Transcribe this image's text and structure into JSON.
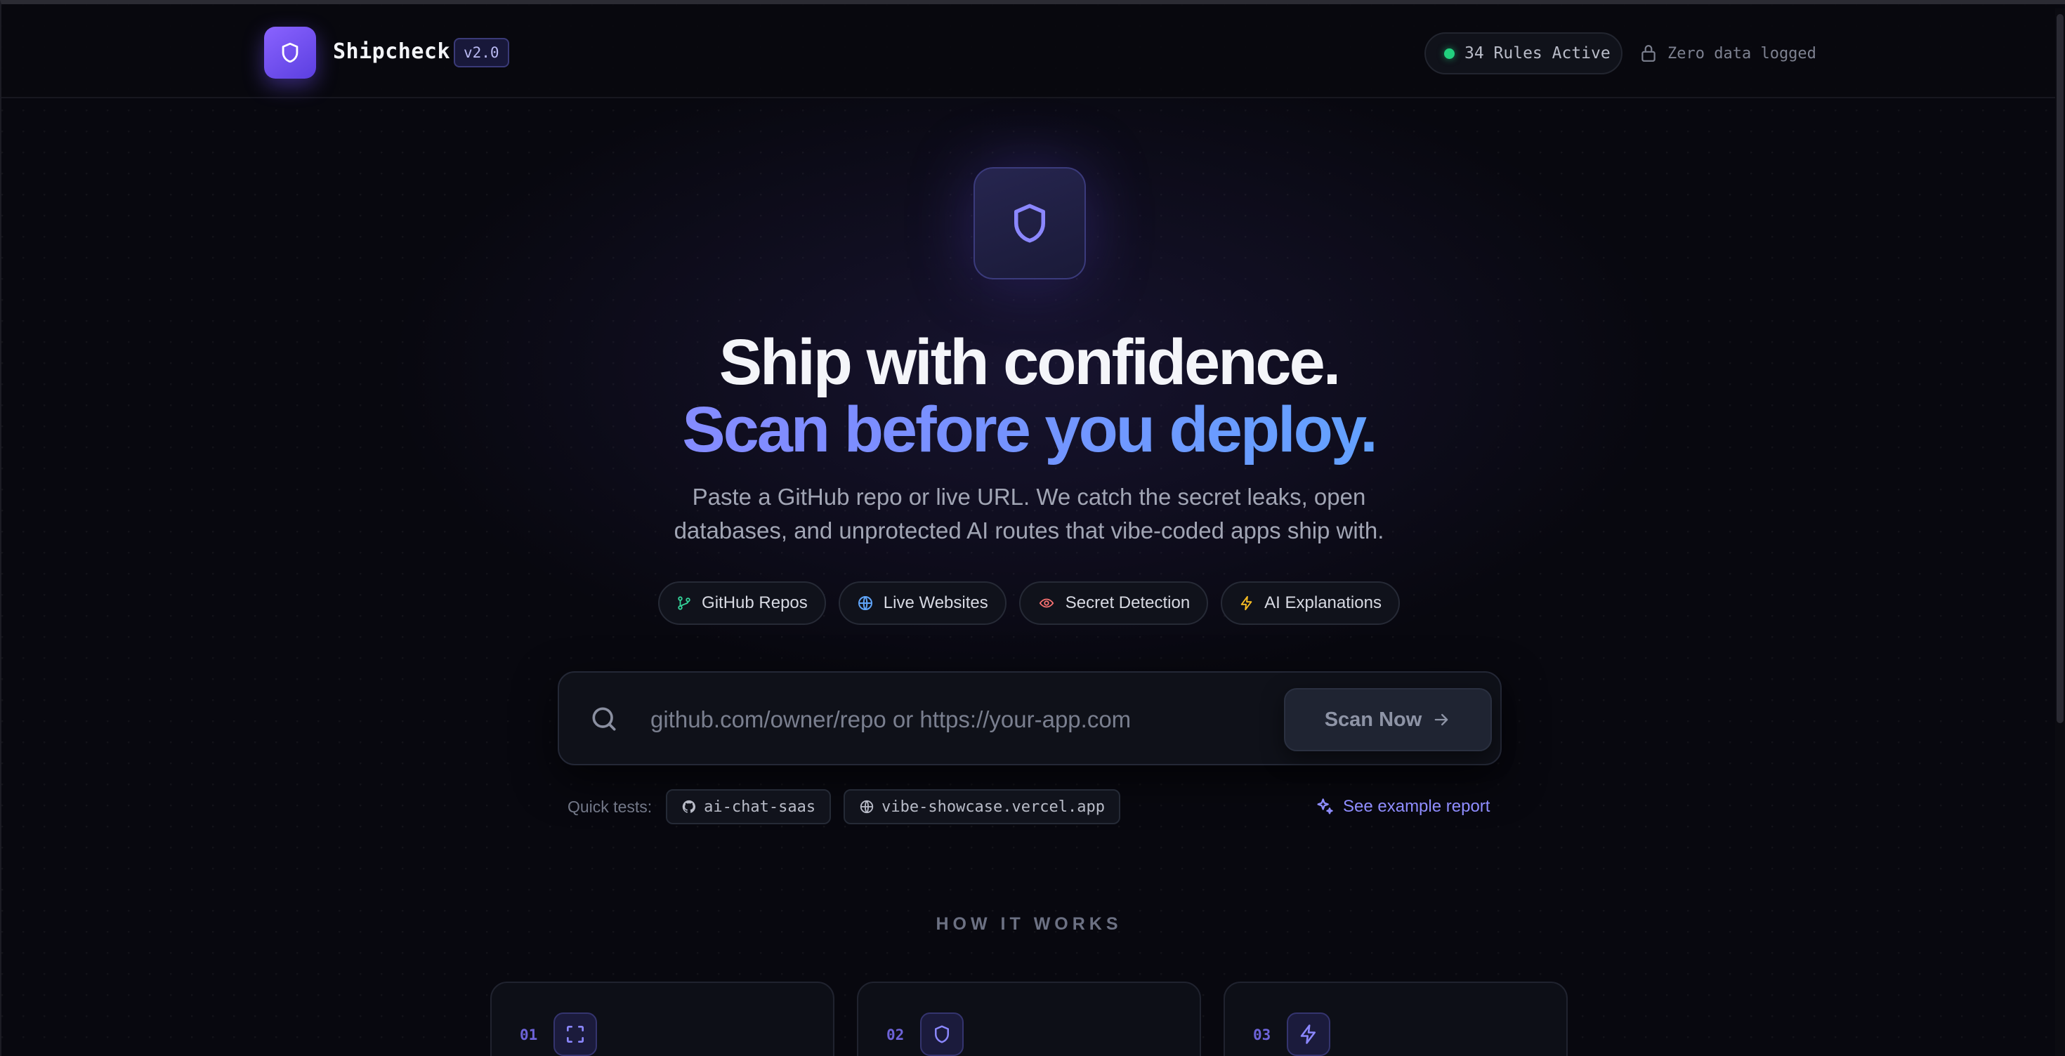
{
  "header": {
    "brand": "Shipcheck",
    "version": "v2.0",
    "rules_active": "34 Rules Active",
    "privacy": "Zero data logged"
  },
  "hero": {
    "headline_line1": "Ship with confidence.",
    "headline_line2": "Scan before you deploy.",
    "subtitle": "Paste a GitHub repo or live URL. We catch the secret leaks, open databases, and unprotected AI routes that vibe-coded apps ship with."
  },
  "features": [
    {
      "label": "GitHub Repos",
      "icon": "git-branch-icon",
      "color": "#34d399"
    },
    {
      "label": "Live Websites",
      "icon": "globe-icon",
      "color": "#60a5fa"
    },
    {
      "label": "Secret Detection",
      "icon": "eye-icon",
      "color": "#f87171"
    },
    {
      "label": "AI Explanations",
      "icon": "bolt-icon",
      "color": "#fbbf24"
    }
  ],
  "search": {
    "placeholder": "github.com/owner/repo or https://your-app.com",
    "button_label": "Scan Now"
  },
  "quick_tests": {
    "label": "Quick tests:",
    "items": [
      {
        "label": "ai-chat-saas",
        "icon": "github-icon"
      },
      {
        "label": "vibe-showcase.vercel.app",
        "icon": "globe-icon"
      }
    ],
    "example_link": "See example report"
  },
  "how_it_works": {
    "title": "HOW IT WORKS",
    "steps": [
      {
        "number": "01",
        "icon": "scan-icon"
      },
      {
        "number": "02",
        "icon": "shield-icon"
      },
      {
        "number": "03",
        "icon": "bolt-icon"
      }
    ]
  },
  "colors": {
    "accent": "#7c5cff",
    "background": "#08080f",
    "status_green": "#22d07e",
    "link": "#8f8dff"
  }
}
